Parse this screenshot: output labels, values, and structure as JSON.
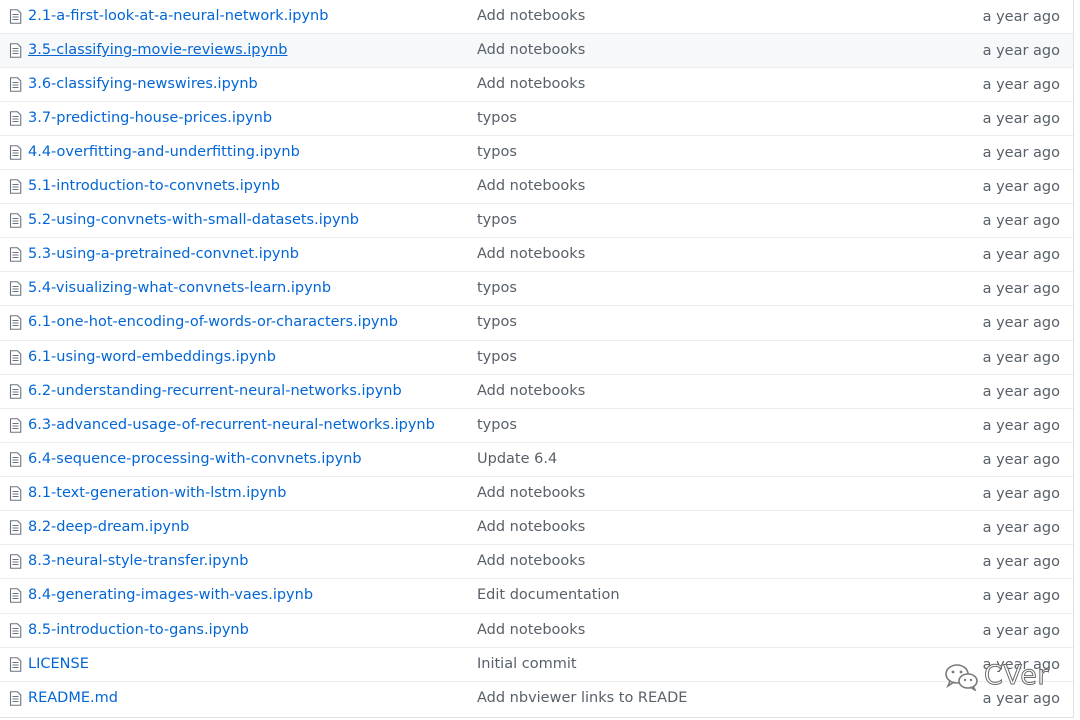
{
  "files": [
    {
      "name": "2.1-a-first-look-at-a-neural-network.ipynb",
      "message": "Add notebooks",
      "age": "a year ago",
      "icon": "file-icon"
    },
    {
      "name": "3.5-classifying-movie-reviews.ipynb",
      "message": "Add notebooks",
      "age": "a year ago",
      "icon": "file-icon"
    },
    {
      "name": "3.6-classifying-newswires.ipynb",
      "message": "Add notebooks",
      "age": "a year ago",
      "icon": "file-icon"
    },
    {
      "name": "3.7-predicting-house-prices.ipynb",
      "message": "typos",
      "age": "a year ago",
      "icon": "file-icon"
    },
    {
      "name": "4.4-overfitting-and-underfitting.ipynb",
      "message": "typos",
      "age": "a year ago",
      "icon": "file-icon"
    },
    {
      "name": "5.1-introduction-to-convnets.ipynb",
      "message": "Add notebooks",
      "age": "a year ago",
      "icon": "file-icon"
    },
    {
      "name": "5.2-using-convnets-with-small-datasets.ipynb",
      "message": "typos",
      "age": "a year ago",
      "icon": "file-icon"
    },
    {
      "name": "5.3-using-a-pretrained-convnet.ipynb",
      "message": "Add notebooks",
      "age": "a year ago",
      "icon": "file-icon"
    },
    {
      "name": "5.4-visualizing-what-convnets-learn.ipynb",
      "message": "typos",
      "age": "a year ago",
      "icon": "file-icon"
    },
    {
      "name": "6.1-one-hot-encoding-of-words-or-characters.ipynb",
      "message": "typos",
      "age": "a year ago",
      "icon": "file-icon"
    },
    {
      "name": "6.1-using-word-embeddings.ipynb",
      "message": "typos",
      "age": "a year ago",
      "icon": "file-icon"
    },
    {
      "name": "6.2-understanding-recurrent-neural-networks.ipynb",
      "message": "Add notebooks",
      "age": "a year ago",
      "icon": "file-icon"
    },
    {
      "name": "6.3-advanced-usage-of-recurrent-neural-networks.ipynb",
      "message": "typos",
      "age": "a year ago",
      "icon": "file-icon"
    },
    {
      "name": "6.4-sequence-processing-with-convnets.ipynb",
      "message": "Update 6.4",
      "age": "a year ago",
      "icon": "file-icon"
    },
    {
      "name": "8.1-text-generation-with-lstm.ipynb",
      "message": "Add notebooks",
      "age": "a year ago",
      "icon": "file-icon"
    },
    {
      "name": "8.2-deep-dream.ipynb",
      "message": "Add notebooks",
      "age": "a year ago",
      "icon": "file-icon"
    },
    {
      "name": "8.3-neural-style-transfer.ipynb",
      "message": "Add notebooks",
      "age": "a year ago",
      "icon": "file-icon"
    },
    {
      "name": "8.4-generating-images-with-vaes.ipynb",
      "message": "Edit documentation",
      "age": "a year ago",
      "icon": "file-icon"
    },
    {
      "name": "8.5-introduction-to-gans.ipynb",
      "message": "Add notebooks",
      "age": "a year ago",
      "icon": "file-icon"
    },
    {
      "name": "LICENSE",
      "message": "Initial commit",
      "age": "a year ago",
      "icon": "file-icon"
    },
    {
      "name": "README.md",
      "message": "Add nbviewer links to READE",
      "age": "a year ago",
      "icon": "file-icon"
    }
  ],
  "hovered_row": 1,
  "watermark": {
    "text": "CVer",
    "icon": "wechat-logo-icon"
  },
  "colors": {
    "link": "#0366d6",
    "muted": "#586069",
    "border": "#eaecef",
    "hover_bg": "#f6f8fa"
  }
}
